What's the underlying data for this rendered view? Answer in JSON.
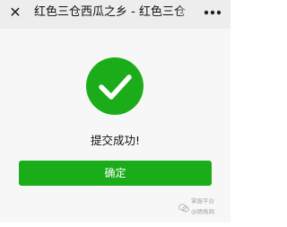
{
  "nav": {
    "close_glyph": "✕",
    "title": "红色三仓西瓜之乡 - 红色三仓",
    "more_icon": "more-dots-icon"
  },
  "result": {
    "icon": "check-circle-icon",
    "message": "提交成功!",
    "confirm_label": "确定"
  },
  "watermark": {
    "line1": "掌握平台",
    "line2": "@精格网"
  },
  "colors": {
    "brand_green": "#1aad19",
    "nav_background": "#ededed",
    "content_background": "#f7f7f7"
  }
}
